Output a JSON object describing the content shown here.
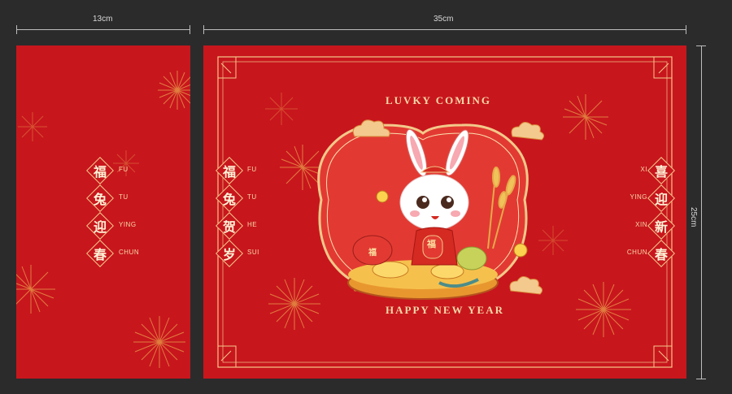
{
  "dimensions": {
    "left_width_label": "13cm",
    "right_width_label": "35cm",
    "height_label": "25cm"
  },
  "left_panel": {
    "characters": [
      "福",
      "兔",
      "迎",
      "春"
    ],
    "pinyin": [
      "FU",
      "TU",
      "YING",
      "CHUN"
    ]
  },
  "right_panel": {
    "top_text": "LUVKY COMING",
    "bottom_text": "HAPPY NEW YEAR",
    "left_column": {
      "characters": [
        "福",
        "兔",
        "贺",
        "岁"
      ],
      "pinyin": [
        "FU",
        "TU",
        "HE",
        "SUI"
      ]
    },
    "right_column": {
      "characters": [
        "喜",
        "迎",
        "新",
        "春"
      ],
      "pinyin": [
        "XI",
        "YING",
        "XIN",
        "CHUN"
      ]
    },
    "rabbit_badge": "福",
    "bag_badge": "福"
  },
  "colors": {
    "background": "#2b2b2b",
    "panel_red": "#c8161d",
    "gold": "#f2c98a",
    "cream": "#fff3d6"
  }
}
